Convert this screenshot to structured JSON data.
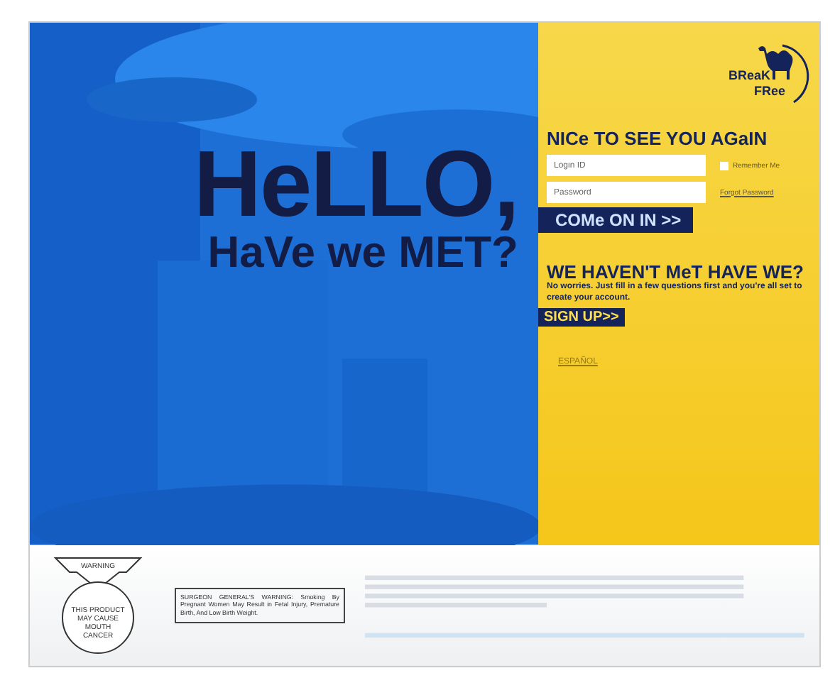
{
  "hero": {
    "headline": "HeLLO,",
    "subheadline": "HaVe we MET?"
  },
  "logo": {
    "line_1": "BReaK",
    "line_2": "FRee"
  },
  "login": {
    "title": "NICe TO SEE YOU AGaIN",
    "login_field": {
      "placeholder": "Login ID"
    },
    "password_field": {
      "placeholder": "Password"
    },
    "remember": {
      "label": "Remember Me",
      "checked": false
    },
    "forgot_link": "Forgot Password",
    "submit": "COMe ON IN >>"
  },
  "signup": {
    "title": "WE HAVEN'T MeT HAVE WE?",
    "text": "No worries. Just fill in a few questions first and you're all set to create your account.",
    "button": "SIGN UP>>"
  },
  "language_link": "ESPAÑOL",
  "footer": {
    "warning_label": {
      "header": "WARNING",
      "body": "THIS PRODUCT MAY CAUSE MOUTH CANCER"
    },
    "surgeon_general": "SURGEON GENERAL'S WARNING: Smoking By Pregnant Women May Result in Fetal Injury, Premature Birth, And Low Birth Weight."
  }
}
